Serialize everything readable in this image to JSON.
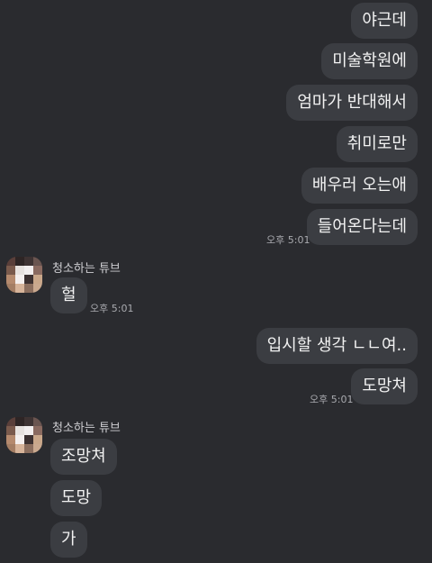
{
  "messages_out_1": [
    "야근데",
    "미술학원에",
    "엄마가 반대해서",
    "취미로만",
    "배우러 오는애",
    "들어온다는데"
  ],
  "time_out_1": "오후 5:01",
  "friend_name": "청소하는 튜브",
  "msg_in_1": "헐",
  "time_in_1": "오후 5:01",
  "messages_out_2": [
    "입시할 생각 ㄴㄴ여..",
    "도망쳐"
  ],
  "time_out_2": "오후 5:01",
  "messages_in_2": [
    "조망쳐",
    "도망",
    "가"
  ]
}
